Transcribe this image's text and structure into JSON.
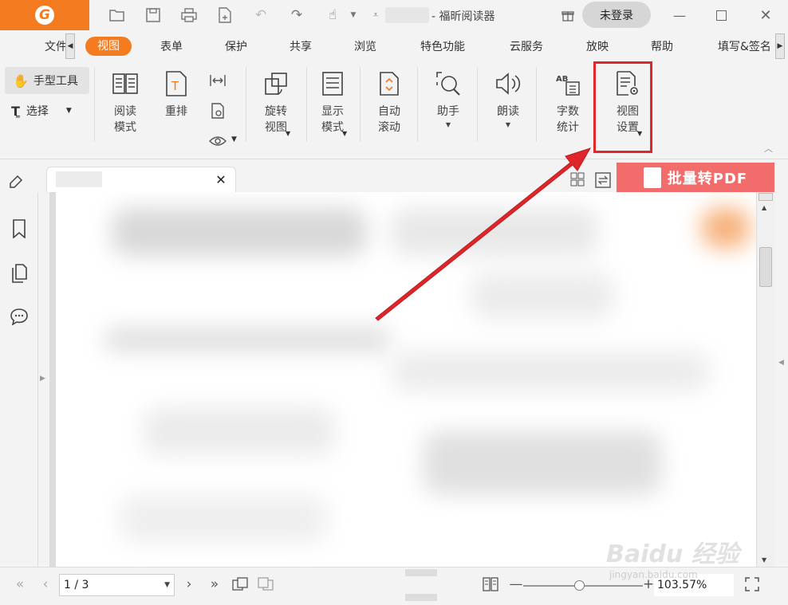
{
  "titlebar": {
    "logo": "G",
    "app_title": "- 福昕阅读器",
    "login_label": "未登录"
  },
  "menu": {
    "items": [
      "文件",
      "视图",
      "表单",
      "保护",
      "共享",
      "浏览",
      "特色功能",
      "云服务",
      "放映",
      "帮助",
      "填写&签名"
    ],
    "active": "视图"
  },
  "ribbon": {
    "hand_tool": "手型工具",
    "select_tool": "选择",
    "buttons": {
      "read_mode": "阅读\n模式",
      "reflow": "重排",
      "rotate_view": "旋转\n视图",
      "display_mode": "显示\n模式",
      "auto_scroll": "自动\n滚动",
      "assistant": "助手",
      "read_aloud": "朗读",
      "word_count": "字数\n统计",
      "view_settings": "视图\n设置"
    }
  },
  "batch_pdf_label": "批量转PDF",
  "status": {
    "page": "1 / 3",
    "zoom": "103.57%",
    "zoom_fraction": 0.47
  },
  "watermark": {
    "brand": "Baidu 经验",
    "url": "jingyan.baidu.com"
  },
  "colors": {
    "accent": "#f47b20",
    "highlight": "#e0262a",
    "arrow": "#e0262a",
    "batch_bg": "#f26c6c"
  }
}
